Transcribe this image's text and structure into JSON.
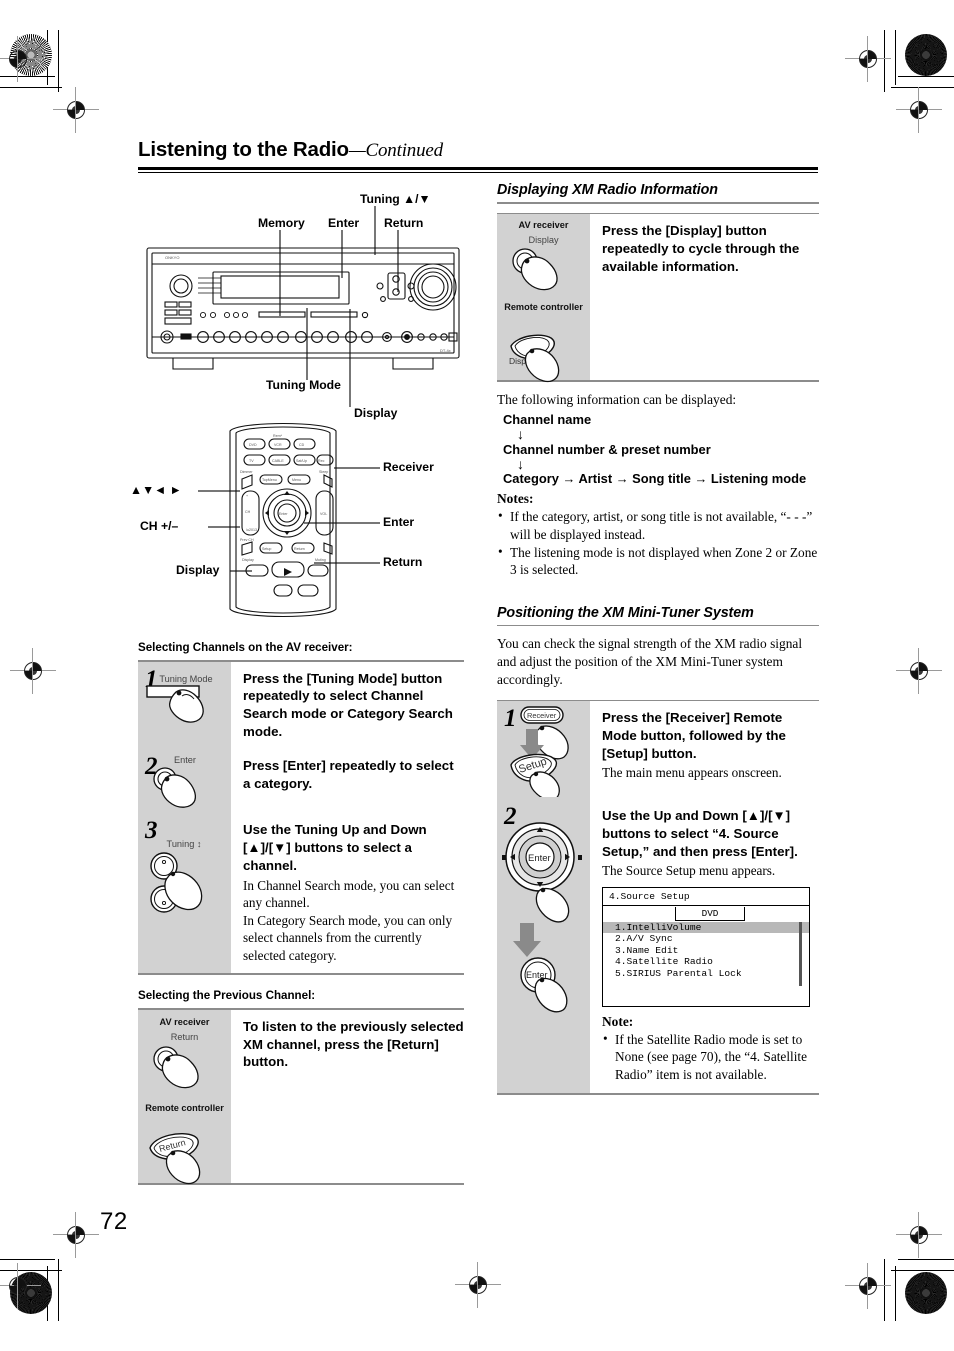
{
  "page": {
    "number": "72",
    "header_title": "Listening to the Radio",
    "header_suffix": "—Continued"
  },
  "left_column": {
    "receiver_diagram": {
      "name": "av-receiver-front-panel",
      "callouts": [
        {
          "label": "Tuning ▲/▼",
          "position": "top"
        },
        {
          "label": "Memory",
          "position": "top"
        },
        {
          "label": "Enter",
          "position": "top"
        },
        {
          "label": "Return",
          "position": "top"
        },
        {
          "label": "Tuning Mode",
          "position": "bottom"
        },
        {
          "label": "Display",
          "position": "bottom"
        }
      ]
    },
    "remote_diagram": {
      "name": "remote-controller",
      "callouts_left": [
        "▲▼◄ ►",
        "CH +/–",
        "Display"
      ],
      "callouts_right": [
        "Receiver",
        "Enter",
        "Return"
      ]
    },
    "section_a": {
      "heading": "Selecting Channels on the AV receiver:",
      "steps": [
        {
          "number": "1",
          "art_label": "Tuning Mode",
          "art_type": "bar-button",
          "lead": "Press the [Tuning Mode] button repeatedly to select Channel Search mode or Category Search mode.",
          "sub": ""
        },
        {
          "number": "2",
          "art_label": "Enter",
          "art_type": "round-button",
          "lead": "Press [Enter] repeatedly to select a category.",
          "sub": ""
        },
        {
          "number": "3",
          "art_label": "Tuning ↕",
          "art_type": "two-knobs",
          "lead": "Use the Tuning Up and Down [▲]/[▼] buttons to select a channel.",
          "sub": "In Channel Search mode, you can select any channel.\nIn Category Search mode, you can only select channels from the currently selected category."
        }
      ]
    },
    "section_b": {
      "heading": "Selecting the Previous Channel:",
      "box": {
        "art_labels": {
          "device_top": "AV receiver",
          "button_top": "Return",
          "device_bottom": "Remote controller",
          "button_bottom": "Return"
        },
        "lead": "To listen to the previously selected XM channel, press the [Return] button."
      }
    }
  },
  "right_column": {
    "section_display": {
      "heading": "Displaying XM Radio Information",
      "box": {
        "art_labels": {
          "device_top": "AV receiver",
          "button_top": "Display",
          "device_bottom": "Remote controller",
          "button_bottom": "Display"
        },
        "lead": "Press the [Display] button repeatedly to cycle through the available information."
      },
      "intro": "The following information can be displayed:",
      "flow": [
        "Channel name",
        "Channel number & preset number",
        "Category → Artist → Song title → Listening mode"
      ],
      "arrow": "↓",
      "notes_heading": "Notes:",
      "notes": [
        "If the category, artist, or song title is not available, “- - -” will be displayed instead.",
        "The listening mode is not displayed when Zone 2 or Zone 3 is selected."
      ]
    },
    "section_positioning": {
      "heading": "Positioning the XM Mini-Tuner System",
      "intro": "You can check the signal strength of the XM radio signal and adjust the position of the XM Mini-Tuner system accordingly.",
      "steps": [
        {
          "number": "1",
          "art_buttons": [
            "Receiver",
            "Setup"
          ],
          "lead": "Press the [Receiver] Remote Mode button, followed by the [Setup] button.",
          "sub": "The main menu appears onscreen."
        },
        {
          "number": "2",
          "art_buttons": [
            "Enter",
            "Enter"
          ],
          "lead": "Use the Up and Down [▲]/[▼] buttons to select “4. Source Setup,” and then press [Enter].",
          "sub": "The Source Setup menu appears."
        }
      ],
      "osd": {
        "title": "4.Source Setup",
        "tab": "DVD",
        "rows": [
          {
            "text": "1.IntelliVolume",
            "selected": true
          },
          {
            "text": "2.A/V Sync",
            "selected": false
          },
          {
            "text": "3.Name Edit",
            "selected": false
          },
          {
            "text": "4.Satellite Radio",
            "selected": false
          },
          {
            "text": "5.SIRIUS Parental Lock",
            "selected": false
          }
        ]
      },
      "note_heading": "Note:",
      "notes": [
        "If the Satellite Radio mode is set to None (see page 70), the “4. Satellite Radio” item is not available."
      ]
    }
  },
  "colors": {
    "box_grey": "#d2d2d2",
    "rule_grey": "#8c8c8c",
    "osd_highlight": "#b8b8b8",
    "page_bg": "#ffffff"
  }
}
